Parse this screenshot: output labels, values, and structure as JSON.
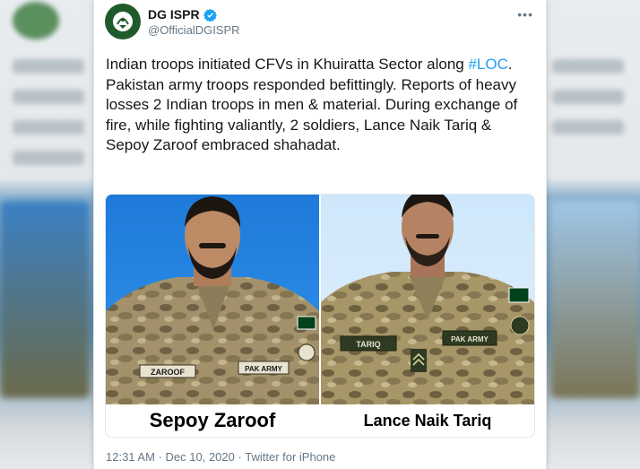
{
  "tweet": {
    "display_name": "DG ISPR",
    "handle": "@OfficialDGISPR",
    "more_icon": "more-options-icon",
    "text_before_hashtag": "Indian troops initiated CFVs in Khuiratta Sector along ",
    "hashtag": "#LOC",
    "text_after_hashtag": ". Pakistan army troops responded befittingly. Reports of heavy losses 2 Indian troops in men & material. During exchange of fire, while fighting valiantly, 2 soldiers, Lance Naik Tariq & Sepoy Zaroof embraced shahadat.",
    "time": "12:31 AM",
    "separator": "·",
    "date": "Dec 10, 2020",
    "source": "Twitter for iPhone"
  },
  "media": {
    "left": {
      "caption": "Sepoy Zaroof",
      "name_tape": "ZAROOF",
      "unit_tape": "PAK ARMY"
    },
    "right": {
      "caption": "Lance Naik Tariq",
      "name_tape": "TARIQ",
      "unit_tape": "PAK ARMY"
    }
  },
  "colors": {
    "link": "#1da1f2",
    "text": "#14171a",
    "secondary": "#657786",
    "verified": "#1da1f2",
    "camo_base": "#9a8a5e"
  }
}
